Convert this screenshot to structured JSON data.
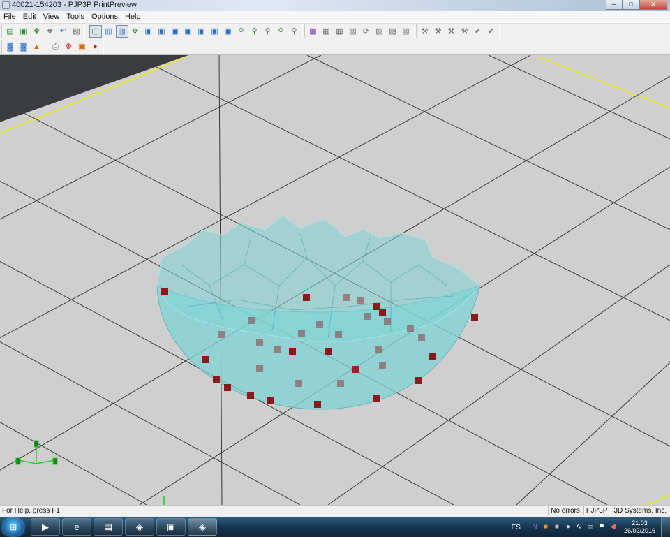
{
  "window": {
    "title": "40021-154203 - PJP3P PrintPreview",
    "controls": {
      "minimize": "─",
      "maximize": "□",
      "close": "✕"
    }
  },
  "menu": {
    "items": [
      "File",
      "Edit",
      "View",
      "Tools",
      "Options",
      "Help"
    ]
  },
  "toolbar1": {
    "group_file": [
      {
        "icon": "open-folder-icon",
        "glyph": "▤",
        "color": "green"
      },
      {
        "icon": "load-model-icon",
        "glyph": "▣",
        "color": "green"
      },
      {
        "icon": "add-model-icon",
        "glyph": "❖",
        "color": "green"
      },
      {
        "icon": "remove-model-icon",
        "glyph": "❖",
        "color": "gray"
      },
      {
        "icon": "undo-icon",
        "glyph": "↶",
        "color": "blue"
      },
      {
        "icon": "copy-icon",
        "glyph": "▧",
        "color": "gray"
      }
    ],
    "group_view": [
      {
        "icon": "view-perspective-icon",
        "glyph": "▢",
        "color": "green",
        "pressed": true
      },
      {
        "icon": "view-shaded-icon",
        "glyph": "▥",
        "color": "blue"
      },
      {
        "icon": "view-transparent-icon",
        "glyph": "▥",
        "color": "blue",
        "pressed": true
      },
      {
        "icon": "pan-icon",
        "glyph": "✥",
        "color": "green"
      },
      {
        "icon": "view-top-icon",
        "glyph": "▣",
        "color": "blue"
      },
      {
        "icon": "view-bottom-icon",
        "glyph": "▣",
        "color": "blue"
      },
      {
        "icon": "view-front-icon",
        "glyph": "▣",
        "color": "blue"
      },
      {
        "icon": "view-back-icon",
        "glyph": "▣",
        "color": "blue"
      },
      {
        "icon": "view-left-icon",
        "glyph": "▣",
        "color": "blue"
      },
      {
        "icon": "view-right-icon",
        "glyph": "▣",
        "color": "blue"
      },
      {
        "icon": "view-iso-icon",
        "glyph": "▣",
        "color": "blue"
      },
      {
        "icon": "zoom-in-icon",
        "glyph": "⚲",
        "color": "green"
      },
      {
        "icon": "zoom-out-icon",
        "glyph": "⚲",
        "color": "green"
      },
      {
        "icon": "zoom-window-icon",
        "glyph": "⚲",
        "color": "gray"
      },
      {
        "icon": "zoom-fit-icon",
        "glyph": "⚲",
        "color": "green"
      },
      {
        "icon": "zoom-all-icon",
        "glyph": "⚲",
        "color": "gray"
      }
    ],
    "group_edit": [
      {
        "icon": "color-palette-icon",
        "glyph": "▦",
        "color": "purple"
      },
      {
        "icon": "grid-icon",
        "glyph": "▦",
        "color": "gray"
      },
      {
        "icon": "layout-icon",
        "glyph": "▦",
        "color": "gray"
      },
      {
        "icon": "move-icon",
        "glyph": "▨",
        "color": "gray"
      },
      {
        "icon": "rotate-icon",
        "glyph": "⟳",
        "color": "gray"
      },
      {
        "icon": "scale-icon",
        "glyph": "▨",
        "color": "gray"
      },
      {
        "icon": "mirror-icon",
        "glyph": "▨",
        "color": "gray"
      },
      {
        "icon": "measure-icon",
        "glyph": "▨",
        "color": "gray"
      }
    ],
    "group_support": [
      {
        "icon": "support-auto-icon",
        "glyph": "⚒",
        "color": "gray"
      },
      {
        "icon": "support-edit-icon",
        "glyph": "⚒",
        "color": "gray"
      },
      {
        "icon": "support-point-icon",
        "glyph": "⚒",
        "color": "gray"
      },
      {
        "icon": "support-line-icon",
        "glyph": "⚒",
        "color": "gray"
      },
      {
        "icon": "support-check-icon",
        "glyph": "✔",
        "color": "gray"
      },
      {
        "icon": "support-delete-icon",
        "glyph": "✔",
        "color": "gray"
      }
    ]
  },
  "toolbar2": {
    "group_build": [
      {
        "icon": "build-chart-icon",
        "glyph": "▓",
        "color": "blue"
      },
      {
        "icon": "build-stats-icon",
        "glyph": "▓",
        "color": "blue"
      },
      {
        "icon": "build-arrange-icon",
        "glyph": "▲",
        "color": "orange"
      }
    ],
    "group_print": [
      {
        "icon": "printer-icon",
        "glyph": "⎙",
        "color": "gray"
      },
      {
        "icon": "printer-settings-icon",
        "glyph": "⚙",
        "color": "red"
      },
      {
        "icon": "print-job-icon",
        "glyph": "▣",
        "color": "orange"
      },
      {
        "icon": "stop-icon",
        "glyph": "●",
        "color": "red"
      }
    ]
  },
  "viewport": {
    "platform_color": "#cfcfcf",
    "grid_color": "#3a3a3a",
    "edge_color": "#e6e63a",
    "model_color": "#7fd3d6",
    "support_color": "#8b1a1a",
    "axis_color": "#22cc22"
  },
  "statusbar": {
    "help": "For Help, press F1",
    "panels": [
      "No errors",
      "PJP3P",
      "3D Systems, Inc."
    ]
  },
  "taskbar": {
    "start_glyph": "⊞",
    "items": [
      {
        "icon": "media-player-icon",
        "glyph": "▶"
      },
      {
        "icon": "internet-explorer-icon",
        "glyph": "e"
      },
      {
        "icon": "file-explorer-icon",
        "glyph": "▤"
      },
      {
        "icon": "app-3d-icon",
        "glyph": "◈"
      },
      {
        "icon": "terminal-icon",
        "glyph": "▣"
      },
      {
        "icon": "printpreview-icon",
        "glyph": "◈",
        "active": true
      }
    ],
    "language": "ES",
    "tray": [
      {
        "icon": "onenote-icon",
        "glyph": "N",
        "color": "#9b59d0"
      },
      {
        "icon": "update-icon",
        "glyph": "■",
        "color": "#e8932c"
      },
      {
        "icon": "security-icon",
        "glyph": "■",
        "color": "#bdbdbd"
      },
      {
        "icon": "chat-icon",
        "glyph": "●",
        "color": "#cfd8e0"
      },
      {
        "icon": "network-icon",
        "glyph": "∿",
        "color": "#ffffff"
      },
      {
        "icon": "battery-icon",
        "glyph": "▭",
        "color": "#ffffff"
      },
      {
        "icon": "action-center-icon",
        "glyph": "⚑",
        "color": "#ffffff"
      },
      {
        "icon": "volume-icon",
        "glyph": "◀",
        "color": "#ff6a6a"
      }
    ],
    "time": "21:03",
    "date": "26/02/2016"
  }
}
